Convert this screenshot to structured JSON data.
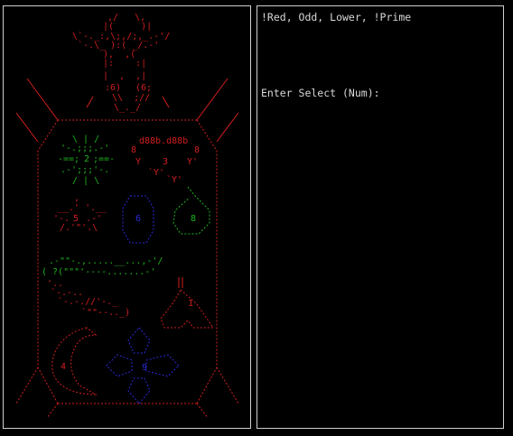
{
  "board": {
    "piece_numbers": {
      "p1": "1",
      "p2": "2",
      "p3": "3",
      "p4": "4",
      "p5": "5",
      "p6": "6",
      "p8": "8",
      "p9": "9"
    },
    "eye_left": ":6)",
    "eye_right": "(6;",
    "bee_label": "d88b.d88b"
  },
  "colors": {
    "red": "#d11f1f",
    "green": "#1fb51f",
    "blue": "#2a2ad8",
    "frame": "#cfcfcf"
  },
  "terminal": {
    "hint": "!Red, Odd, Lower, !Prime",
    "prompt": "Enter Select (Num):"
  }
}
